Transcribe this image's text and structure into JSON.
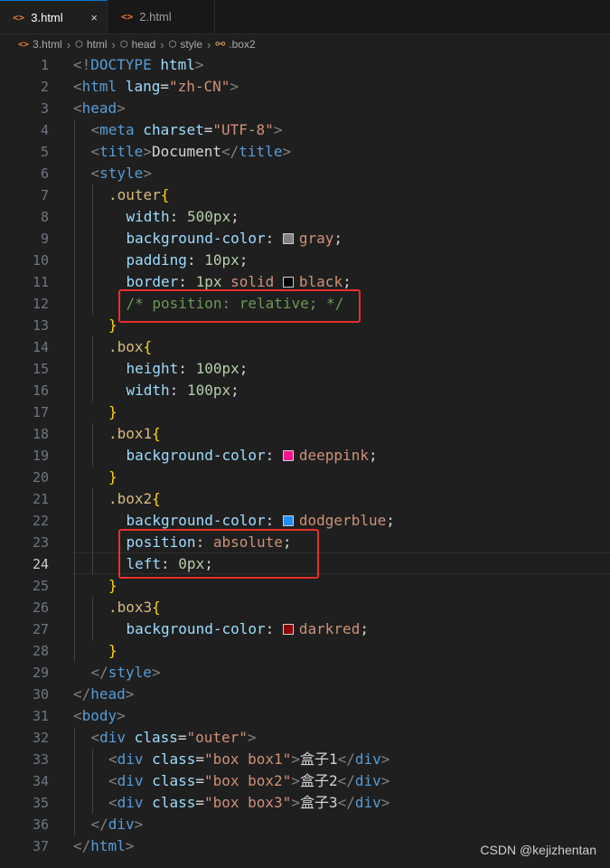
{
  "tabs": [
    {
      "label": "3.html",
      "icon": "html-file-icon",
      "active": true,
      "close": "×"
    },
    {
      "label": "2.html",
      "icon": "html-file-icon",
      "active": false
    }
  ],
  "tab_icon_glyph": "<>",
  "breadcrumb": [
    {
      "label": "3.html",
      "icon": "html-file-icon"
    },
    {
      "label": "html",
      "icon": "element-cube-icon"
    },
    {
      "label": "head",
      "icon": "element-cube-icon"
    },
    {
      "label": "style",
      "icon": "element-cube-icon"
    },
    {
      "label": ".box2",
      "icon": "css-property-icon"
    }
  ],
  "breadcrumb_sep": "›",
  "editor": {
    "active_line": 24,
    "line_numbers": [
      "1",
      "2",
      "3",
      "4",
      "5",
      "6",
      "7",
      "8",
      "9",
      "10",
      "11",
      "12",
      "13",
      "14",
      "15",
      "16",
      "17",
      "18",
      "19",
      "20",
      "21",
      "22",
      "23",
      "24",
      "25",
      "26",
      "27",
      "28",
      "29",
      "30",
      "31",
      "32",
      "33",
      "34",
      "35",
      "36",
      "37"
    ],
    "lines": {
      "l1": [
        "<!",
        "DOCTYPE",
        " html",
        ">"
      ],
      "l2": [
        "<",
        "html",
        " lang",
        "=",
        "\"zh-CN\"",
        ">"
      ],
      "l3": [
        "<",
        "head",
        ">"
      ],
      "l4": [
        "<",
        "meta",
        " charset",
        "=",
        "\"UTF-8\"",
        ">"
      ],
      "l5": [
        "<",
        "title",
        ">",
        "Document",
        "</",
        "title",
        ">"
      ],
      "l6": [
        "<",
        "style",
        ">"
      ],
      "l7": [
        ".outer",
        "{"
      ],
      "l8": [
        "width",
        ": ",
        "500px",
        ";"
      ],
      "l9": [
        "background-color",
        ": ",
        "gray",
        ";"
      ],
      "l10": [
        "padding",
        ": ",
        "10px",
        ";"
      ],
      "l11": [
        "border",
        ": ",
        "1px",
        " solid ",
        "black",
        ";"
      ],
      "l12": [
        "/* position: relative; */"
      ],
      "l13": [
        "}"
      ],
      "l14": [
        ".box",
        "{"
      ],
      "l15": [
        "height",
        ": ",
        "100px",
        ";"
      ],
      "l16": [
        "width",
        ": ",
        "100px",
        ";"
      ],
      "l17": [
        "}"
      ],
      "l18": [
        ".box1",
        "{"
      ],
      "l19": [
        "background-color",
        ": ",
        "deeppink",
        ";"
      ],
      "l20": [
        "}"
      ],
      "l21": [
        ".box2",
        "{"
      ],
      "l22": [
        "background-color",
        ": ",
        "dodgerblue",
        ";"
      ],
      "l23": [
        "position",
        ": ",
        "absolute",
        ";"
      ],
      "l24": [
        "left",
        ": ",
        "0px",
        ";"
      ],
      "l25": [
        "}"
      ],
      "l26": [
        ".box3",
        "{"
      ],
      "l27": [
        "background-color",
        ": ",
        "darkred",
        ";"
      ],
      "l28": [
        "}"
      ],
      "l29": [
        "</",
        "style",
        ">"
      ],
      "l30": [
        "</",
        "head",
        ">"
      ],
      "l31": [
        "<",
        "body",
        ">"
      ],
      "l32": [
        "<",
        "div",
        " class",
        "=",
        "\"outer\"",
        ">"
      ],
      "l33": [
        "<",
        "div",
        " class",
        "=",
        "\"box box1\"",
        ">",
        "盒子1",
        "</",
        "div",
        ">"
      ],
      "l34": [
        "<",
        "div",
        " class",
        "=",
        "\"box box2\"",
        ">",
        "盒子2",
        "</",
        "div",
        ">"
      ],
      "l35": [
        "<",
        "div",
        " class",
        "=",
        "\"box box3\"",
        ">",
        "盒子3",
        "</",
        "div",
        ">"
      ],
      "l36": [
        "</",
        "div",
        ">"
      ],
      "l37": [
        "</",
        "html",
        ">"
      ]
    },
    "swatch_colors": {
      "gray": "#808080",
      "black": "#000000",
      "deeppink": "#ff1493",
      "dodgerblue": "#1e90ff",
      "darkred": "#8b0000"
    }
  },
  "highlights_color": "#e5302b",
  "watermark": "CSDN @kejizhentan"
}
